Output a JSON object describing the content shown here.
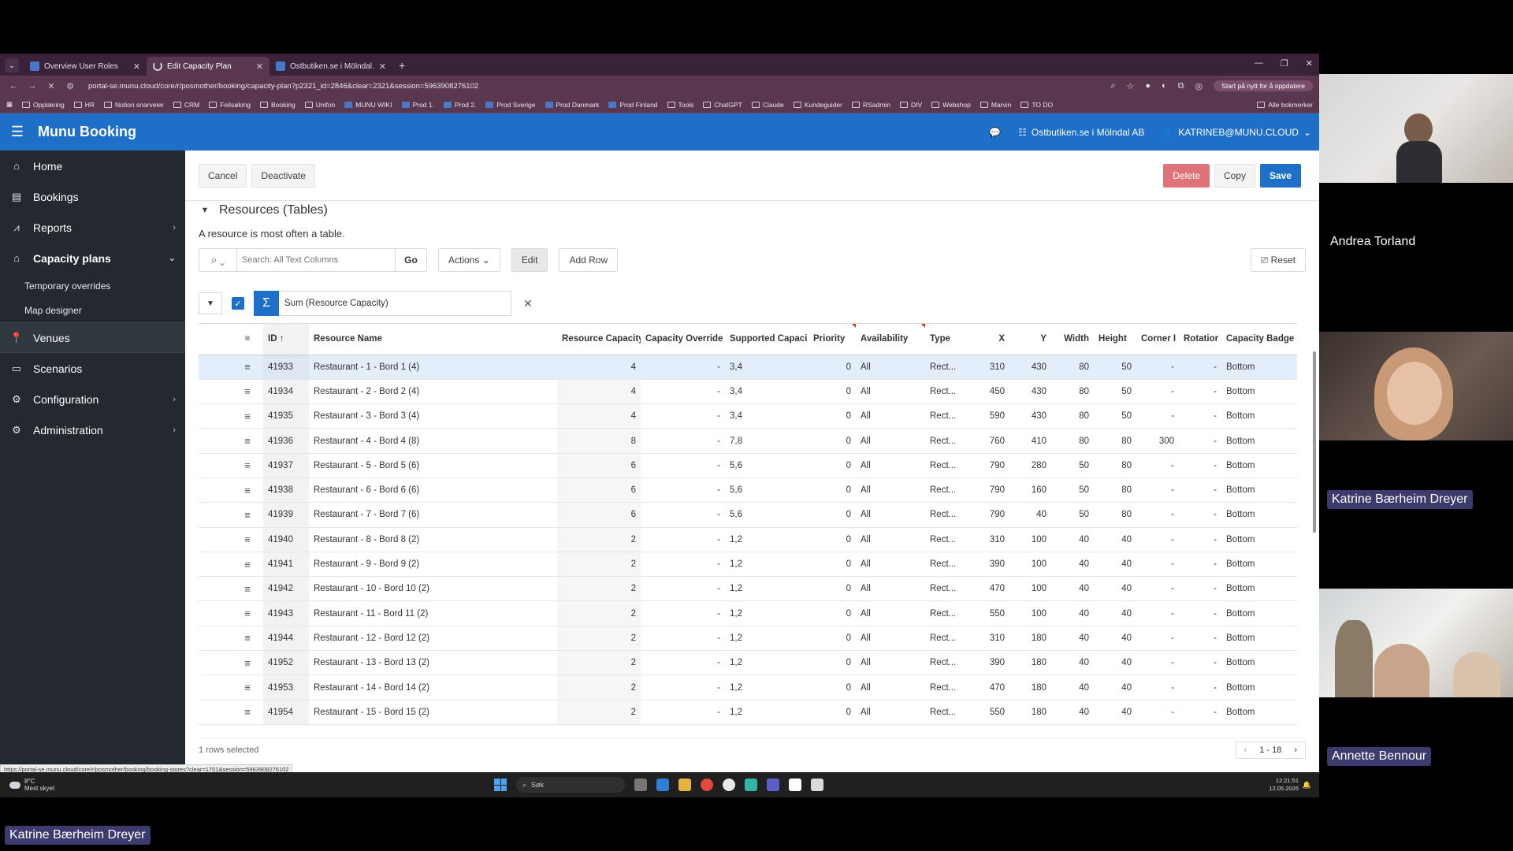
{
  "browser": {
    "tabs": [
      {
        "label": "Overview User Roles",
        "active": false
      },
      {
        "label": "Edit Capacity Plan",
        "active": true
      },
      {
        "label": "Ostbutiken.se i Mölndal AB Bo:",
        "active": false
      }
    ],
    "url": "portal-se.munu.cloud/core/r/posmother/booking/capacity-plan?p2321_id=2846&clear=2321&session=5963908276102",
    "update_label": "Start på nytt for å oppdatere",
    "bookmarks": [
      "Opplæring",
      "HR",
      "Notion snarveier",
      "CRM",
      "Feilsøking",
      "Booking",
      "Unifon",
      "MUNU WIKI",
      "Prod 1.",
      "Prod 2.",
      "Prod Sverige",
      "Prod Danmark",
      "Prod Finland",
      "Tools",
      "ChatGPT",
      "Claude",
      "Kundeguider",
      "RSadmin",
      "DIV",
      "Webshop",
      "Marvin",
      "TO DO"
    ],
    "bookmarks_all": "Alle bokmerker"
  },
  "app": {
    "title": "Munu Booking",
    "company": "Ostbutiken.se i Mölndal AB",
    "user": "KATRINEB@MUNU.CLOUD"
  },
  "sidebar": {
    "items": [
      {
        "label": "Home",
        "icon": "home-icon",
        "chevron": false
      },
      {
        "label": "Bookings",
        "icon": "bookings-icon",
        "chevron": false
      },
      {
        "label": "Reports",
        "icon": "chart-icon",
        "chevron": true
      },
      {
        "label": "Capacity plans",
        "icon": "capacity-icon",
        "chevron": true,
        "expanded": true
      },
      {
        "label": "Venues",
        "icon": "pin-icon",
        "chevron": false
      },
      {
        "label": "Scenarios",
        "icon": "scenario-icon",
        "chevron": false
      },
      {
        "label": "Configuration",
        "icon": "gear-icon",
        "chevron": true
      },
      {
        "label": "Administration",
        "icon": "admin-icon",
        "chevron": true
      }
    ],
    "subitems": [
      "Temporary overrides",
      "Map designer"
    ]
  },
  "toolbar": {
    "cancel": "Cancel",
    "deactivate": "Deactivate",
    "delete": "Delete",
    "copy": "Copy",
    "save": "Save"
  },
  "region": {
    "title": "Resources (Tables)",
    "description": "A resource is most often a table."
  },
  "ig": {
    "search_placeholder": "Search: All Text Columns",
    "go": "Go",
    "actions": "Actions",
    "edit": "Edit",
    "add_row": "Add Row",
    "reset": "Reset",
    "filter_chip": "Sum (Resource Capacity)"
  },
  "grid": {
    "columns": [
      "ID",
      "Resource Name",
      "Resource Capacity",
      "Capacity Override",
      "Supported Capaci",
      "Priority",
      "Availability",
      "Type",
      "X",
      "Y",
      "Width",
      "Height",
      "Corner I",
      "Rotatior",
      "Capacity Badge"
    ],
    "rows": [
      [
        "41933",
        "Restaurant - 1 - Bord 1 (4)",
        "4",
        "-",
        "3,4",
        "0",
        "All",
        "Rect...",
        "310",
        "430",
        "80",
        "50",
        "-",
        "-",
        "Bottom"
      ],
      [
        "41934",
        "Restaurant - 2 - Bord 2 (4)",
        "4",
        "-",
        "3,4",
        "0",
        "All",
        "Rect...",
        "450",
        "430",
        "80",
        "50",
        "-",
        "-",
        "Bottom"
      ],
      [
        "41935",
        "Restaurant - 3 - Bord 3 (4)",
        "4",
        "-",
        "3,4",
        "0",
        "All",
        "Rect...",
        "590",
        "430",
        "80",
        "50",
        "-",
        "-",
        "Bottom"
      ],
      [
        "41936",
        "Restaurant - 4 - Bord 4 (8)",
        "8",
        "-",
        "7,8",
        "0",
        "All",
        "Rect...",
        "760",
        "410",
        "80",
        "80",
        "300",
        "-",
        "Bottom"
      ],
      [
        "41937",
        "Restaurant - 5 - Bord 5 (6)",
        "6",
        "-",
        "5,6",
        "0",
        "All",
        "Rect...",
        "790",
        "280",
        "50",
        "80",
        "-",
        "-",
        "Bottom"
      ],
      [
        "41938",
        "Restaurant - 6 - Bord 6 (6)",
        "6",
        "-",
        "5,6",
        "0",
        "All",
        "Rect...",
        "790",
        "160",
        "50",
        "80",
        "-",
        "-",
        "Bottom"
      ],
      [
        "41939",
        "Restaurant - 7 - Bord 7 (6)",
        "6",
        "-",
        "5,6",
        "0",
        "All",
        "Rect...",
        "790",
        "40",
        "50",
        "80",
        "-",
        "-",
        "Bottom"
      ],
      [
        "41940",
        "Restaurant - 8 - Bord 8 (2)",
        "2",
        "-",
        "1,2",
        "0",
        "All",
        "Rect...",
        "310",
        "100",
        "40",
        "40",
        "-",
        "-",
        "Bottom"
      ],
      [
        "41941",
        "Restaurant - 9 - Bord 9 (2)",
        "2",
        "-",
        "1,2",
        "0",
        "All",
        "Rect...",
        "390",
        "100",
        "40",
        "40",
        "-",
        "-",
        "Bottom"
      ],
      [
        "41942",
        "Restaurant - 10 - Bord 10 (2)",
        "2",
        "-",
        "1,2",
        "0",
        "All",
        "Rect...",
        "470",
        "100",
        "40",
        "40",
        "-",
        "-",
        "Bottom"
      ],
      [
        "41943",
        "Restaurant - 11 - Bord 11 (2)",
        "2",
        "-",
        "1,2",
        "0",
        "All",
        "Rect...",
        "550",
        "100",
        "40",
        "40",
        "-",
        "-",
        "Bottom"
      ],
      [
        "41944",
        "Restaurant - 12 - Bord 12 (2)",
        "2",
        "-",
        "1,2",
        "0",
        "All",
        "Rect...",
        "310",
        "180",
        "40",
        "40",
        "-",
        "-",
        "Bottom"
      ],
      [
        "41952",
        "Restaurant - 13 - Bord 13 (2)",
        "2",
        "-",
        "1,2",
        "0",
        "All",
        "Rect...",
        "390",
        "180",
        "40",
        "40",
        "-",
        "-",
        "Bottom"
      ],
      [
        "41953",
        "Restaurant - 14 - Bord 14 (2)",
        "2",
        "-",
        "1,2",
        "0",
        "All",
        "Rect...",
        "470",
        "180",
        "40",
        "40",
        "-",
        "-",
        "Bottom"
      ],
      [
        "41954",
        "Restaurant - 15 - Bord 15 (2)",
        "2",
        "-",
        "1,2",
        "0",
        "All",
        "Rect...",
        "550",
        "180",
        "40",
        "40",
        "-",
        "-",
        "Bottom"
      ]
    ],
    "selected_row": 0,
    "rows_selected": "1 rows selected",
    "pager": "1 - 18"
  },
  "status_url": "https://portal-se.munu.cloud/core/r/posmother/booking/booking-stores?clear=1701&session=5963908276102",
  "taskbar": {
    "temp": "8°C",
    "weather": "Mest skyet",
    "search": "Søk",
    "time": "12:21:51",
    "date": "12.05.2026"
  },
  "participants": [
    {
      "name": "Andrea Torland"
    },
    {
      "name": "Katrine Bærheim Dreyer"
    },
    {
      "name": "Annette Bennour"
    }
  ],
  "presenter": "Katrine Bærheim Dreyer"
}
